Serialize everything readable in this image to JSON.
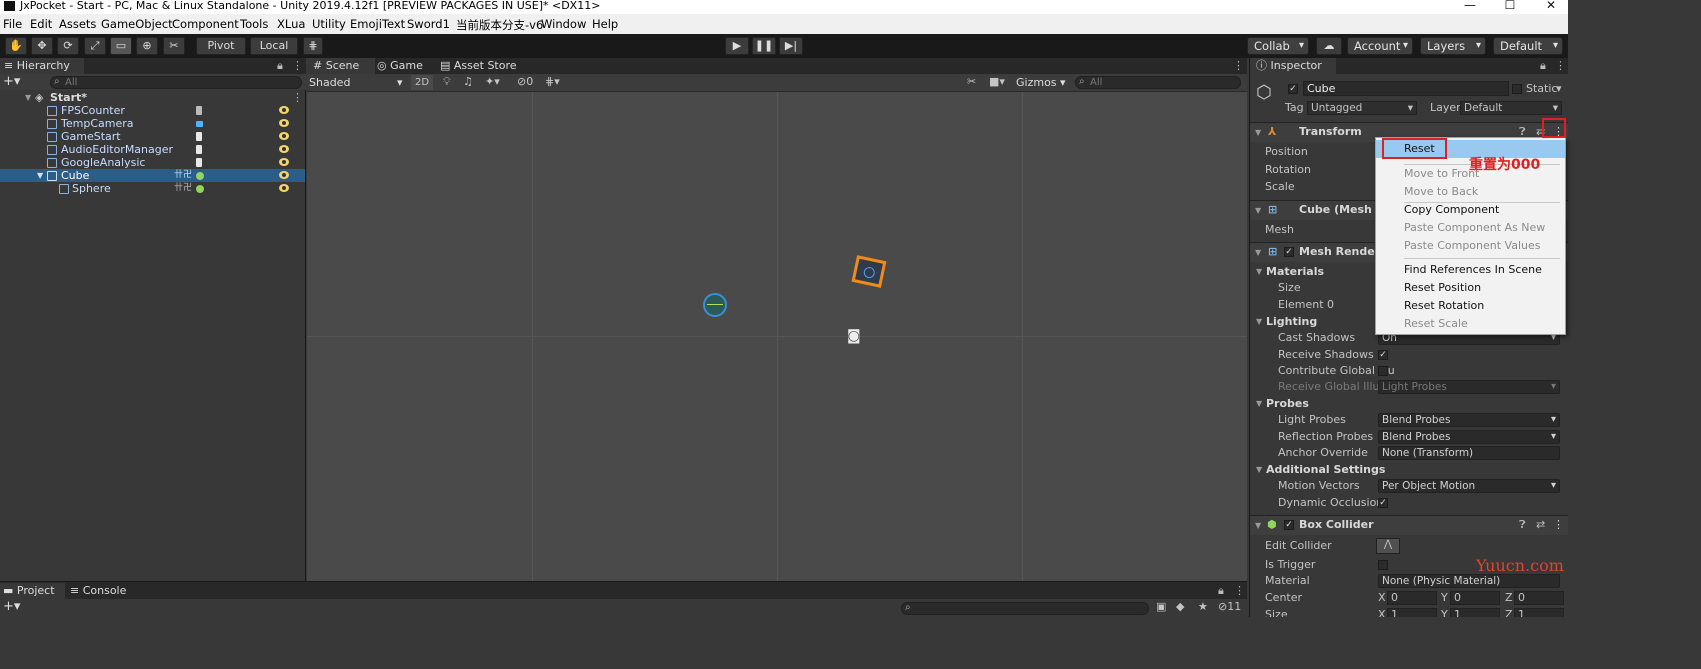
{
  "window": {
    "title": "JxPocket - Start - PC, Mac & Linux Standalone - Unity 2019.4.12f1 [PREVIEW PACKAGES IN USE]* <DX11>"
  },
  "menu": [
    "File",
    "Edit",
    "Assets",
    "GameObject",
    "Component",
    "Tools",
    "XLua",
    "Utility",
    "EmojiText",
    "Sword1",
    "当前版本分支-v6",
    "Window",
    "Help"
  ],
  "toolbar": {
    "pivot": "Pivot",
    "local": "Local",
    "collab": "Collab",
    "account": "Account",
    "layers": "Layers",
    "layout": "Default"
  },
  "hierarchy": {
    "tab": "Hierarchy",
    "search_placeholder": "All",
    "scene_name": "Start*",
    "items": [
      {
        "label": "FPSCounter",
        "depth": 1,
        "selected": false
      },
      {
        "label": "TempCamera",
        "depth": 1,
        "selected": false
      },
      {
        "label": "GameStart",
        "depth": 1,
        "selected": false
      },
      {
        "label": "AudioEditorManager",
        "depth": 1,
        "selected": false
      },
      {
        "label": "GoogleAnalysic",
        "depth": 1,
        "selected": false
      },
      {
        "label": "Cube",
        "depth": 1,
        "selected": true
      },
      {
        "label": "Sphere",
        "depth": 2,
        "selected": false
      }
    ]
  },
  "scene": {
    "tabs": [
      "Scene",
      "Game",
      "Asset Store"
    ],
    "shading": "Shaded",
    "mode_2d": "2D",
    "hidden_count": "0",
    "gizmos": "Gizmos",
    "search_placeholder": "All"
  },
  "inspector": {
    "tab": "Inspector",
    "object_name": "Cube",
    "static_label": "Static",
    "tag_label": "Tag",
    "tag_value": "Untagged",
    "layer_label": "Layer",
    "layer_value": "Default",
    "transform": {
      "title": "Transform",
      "position": "Position",
      "rotation": "Rotation",
      "scale": "Scale"
    },
    "mesh_filter": {
      "title": "Cube (Mesh Filt",
      "mesh": "Mesh"
    },
    "mesh_renderer": {
      "title": "Mesh Renderer",
      "materials": "Materials",
      "size": "Size",
      "element0": "Element 0",
      "lighting": "Lighting",
      "cast_shadows": "Cast Shadows",
      "cast_shadows_value": "On",
      "receive_shadows": "Receive Shadows",
      "contribute_gi": "Contribute Global Illu",
      "receive_gi": "Receive Global Illumi",
      "receive_gi_value": "Light Probes",
      "probes": "Probes",
      "light_probes": "Light Probes",
      "light_probes_value": "Blend Probes",
      "reflection_probes": "Reflection Probes",
      "reflection_probes_value": "Blend Probes",
      "anchor_override": "Anchor Override",
      "anchor_override_value": "None (Transform)",
      "additional": "Additional Settings",
      "motion_vectors": "Motion Vectors",
      "motion_vectors_value": "Per Object Motion",
      "dynamic_occlusion": "Dynamic Occlusion"
    },
    "box_collider": {
      "title": "Box Collider",
      "edit_collider": "Edit Collider",
      "is_trigger": "Is Trigger",
      "material": "Material",
      "material_value": "None (Physic Material)",
      "center": "Center",
      "cx": "0",
      "cy": "0",
      "cz": "0",
      "x": "X",
      "y": "Y",
      "z": "Z",
      "size": "Size",
      "sx": "1",
      "sy": "1",
      "sz": "1"
    }
  },
  "context_menu": {
    "items": [
      {
        "label": "Reset",
        "enabled": true,
        "highlighted": true
      },
      {
        "label": "Move to Front",
        "enabled": false
      },
      {
        "label": "Move to Back",
        "enabled": false
      },
      {
        "label": "Copy Component",
        "enabled": true
      },
      {
        "label": "Paste Component As New",
        "enabled": false
      },
      {
        "label": "Paste Component Values",
        "enabled": false
      },
      {
        "label": "Find References In Scene",
        "enabled": true
      },
      {
        "label": "Reset Position",
        "enabled": true
      },
      {
        "label": "Reset Rotation",
        "enabled": true
      },
      {
        "label": "Reset Scale",
        "enabled": false
      }
    ]
  },
  "annotation": {
    "text": "重置为000"
  },
  "watermark": "Yuucn.com",
  "bottom": {
    "tabs": [
      "Project",
      "Console"
    ],
    "hidden_count": "11"
  },
  "colors": {
    "selection": "#2c5d87",
    "accent_red": "#e02020",
    "eye": "#f2d46b",
    "watermark": "#e0452e"
  }
}
